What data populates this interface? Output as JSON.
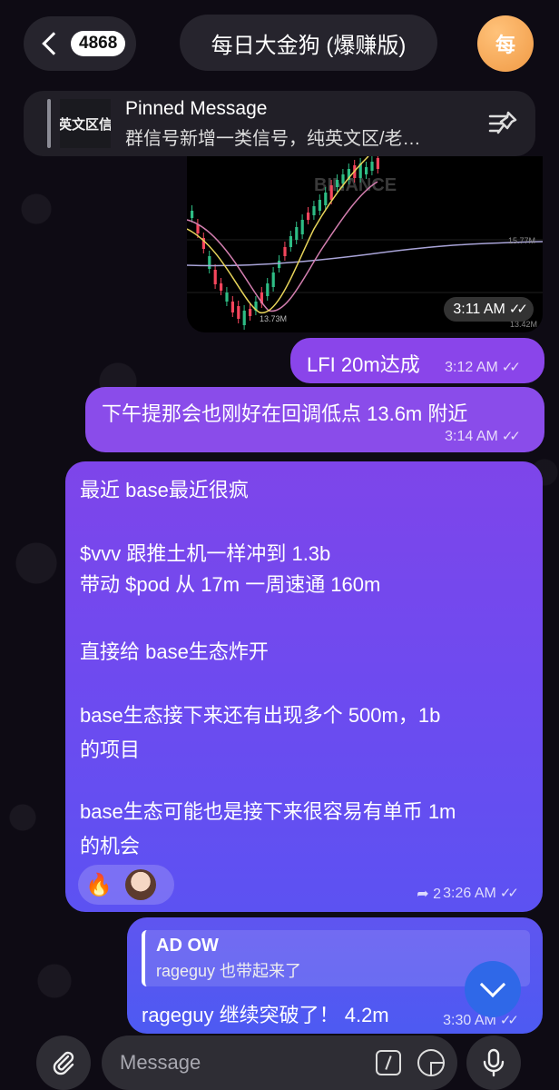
{
  "header": {
    "unread_count": "4868",
    "chat_title": "每日大金狗 (爆赚版)",
    "avatar_letter": "每"
  },
  "pinned": {
    "thumb_text": "英文区信",
    "title": "Pinned Message",
    "preview": "群信号新增一类信号，纯英文区/老…"
  },
  "chart_image": {
    "watermark": "BINANCE",
    "price_labels": [
      "15.77M",
      "13.73M",
      "13.42M"
    ],
    "time": "3:11 AM"
  },
  "messages": [
    {
      "text": "LFI 20m达成",
      "time": "3:12 AM"
    },
    {
      "text": "下午提那会也刚好在回调低点 13.6m 附近",
      "time": "3:14 AM"
    },
    {
      "lines": [
        "最近 base最近很疯",
        "$vvv 跟推土机一样冲到 1.3b",
        "带动 $pod 从 17m 一周速通 160m",
        "直接给 base生态炸开",
        "base生态接下来还有出现多个 500m，1b",
        "的项目",
        "base生态可能也是接下来很容易有单币 1m",
        "的机会"
      ],
      "reaction_emoji": "🔥",
      "reply_count": "2",
      "time": "3:26 AM"
    },
    {
      "quote_name": "AD OW",
      "quote_text": "rageguy 也带起来了",
      "text": "rageguy 继续突破了！  4.2m",
      "time": "3:30 AM"
    }
  ],
  "input": {
    "placeholder": "Message"
  },
  "colors": {
    "accent_purple": "#8a45ea",
    "accent_blue": "#4d5af2",
    "scroll_button": "#2f68e8",
    "avatar_orange": "#f09a45"
  },
  "icons": [
    "chevron-left-icon",
    "pin-icon",
    "fire-icon",
    "reply-icon",
    "chevron-down-icon",
    "paperclip-icon",
    "command-icon",
    "sticker-icon",
    "microphone-icon"
  ]
}
